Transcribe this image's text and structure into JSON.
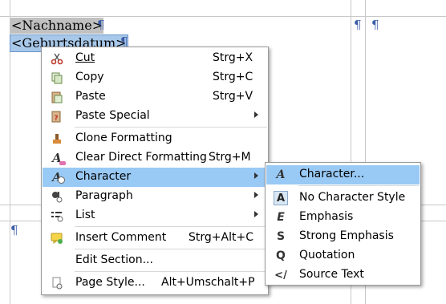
{
  "document": {
    "fields": [
      "<Nachname>",
      "<Geburtsdatum>"
    ],
    "pilcrow": "¶"
  },
  "context_menu": {
    "items": [
      {
        "label": "Cut",
        "mnemonic": "C",
        "rest": "ut",
        "shortcut": "Strg+X",
        "icon": "scissors-icon"
      },
      {
        "label": "Copy",
        "mnemonic": "",
        "rest": "Copy",
        "shortcut": "Strg+C",
        "icon": "copy-icon"
      },
      {
        "label": "Paste",
        "mnemonic": "P",
        "rest": "aste",
        "shortcut": "Strg+V",
        "icon": "paste-icon"
      },
      {
        "label": "Paste Special",
        "shortcut": "",
        "icon": "paste-special-icon",
        "submenu": true
      },
      {
        "label": "Clone Formatting",
        "shortcut": "",
        "icon": "clone-formatting-icon"
      },
      {
        "label": "Clear Direct Formatting",
        "shortcut": "Strg+M",
        "icon": "clear-formatting-icon"
      },
      {
        "label": "Character",
        "shortcut": "",
        "icon": "character-icon",
        "submenu": true,
        "highlighted": true
      },
      {
        "label": "Paragraph",
        "shortcut": "",
        "icon": "paragraph-icon",
        "submenu": true
      },
      {
        "label": "List",
        "shortcut": "",
        "icon": "list-icon",
        "submenu": true
      },
      {
        "label": "Insert Comment",
        "shortcut": "Strg+Alt+C",
        "icon": "comment-icon"
      },
      {
        "label": "Edit Section...",
        "shortcut": "",
        "icon": ""
      },
      {
        "label": "Page Style...",
        "shortcut": "Alt+Umschalt+P",
        "icon": "page-style-icon"
      }
    ]
  },
  "submenu": {
    "items": [
      {
        "label": "Character...",
        "icon": "character-dialog-icon",
        "glyph": "A",
        "highlighted": true
      },
      {
        "label": "No Character Style",
        "icon": "no-character-style-icon",
        "glyph": "A"
      },
      {
        "label": "Emphasis",
        "icon": "emphasis-icon",
        "glyph": "E"
      },
      {
        "label": "Strong Emphasis",
        "icon": "strong-emphasis-icon",
        "glyph": "S"
      },
      {
        "label": "Quotation",
        "icon": "quotation-icon",
        "glyph": "Q"
      },
      {
        "label": "Source Text",
        "icon": "source-text-icon",
        "glyph": "</"
      }
    ]
  },
  "colors": {
    "highlight": "#99c9f5",
    "pilcrow": "#3c5ea8"
  }
}
